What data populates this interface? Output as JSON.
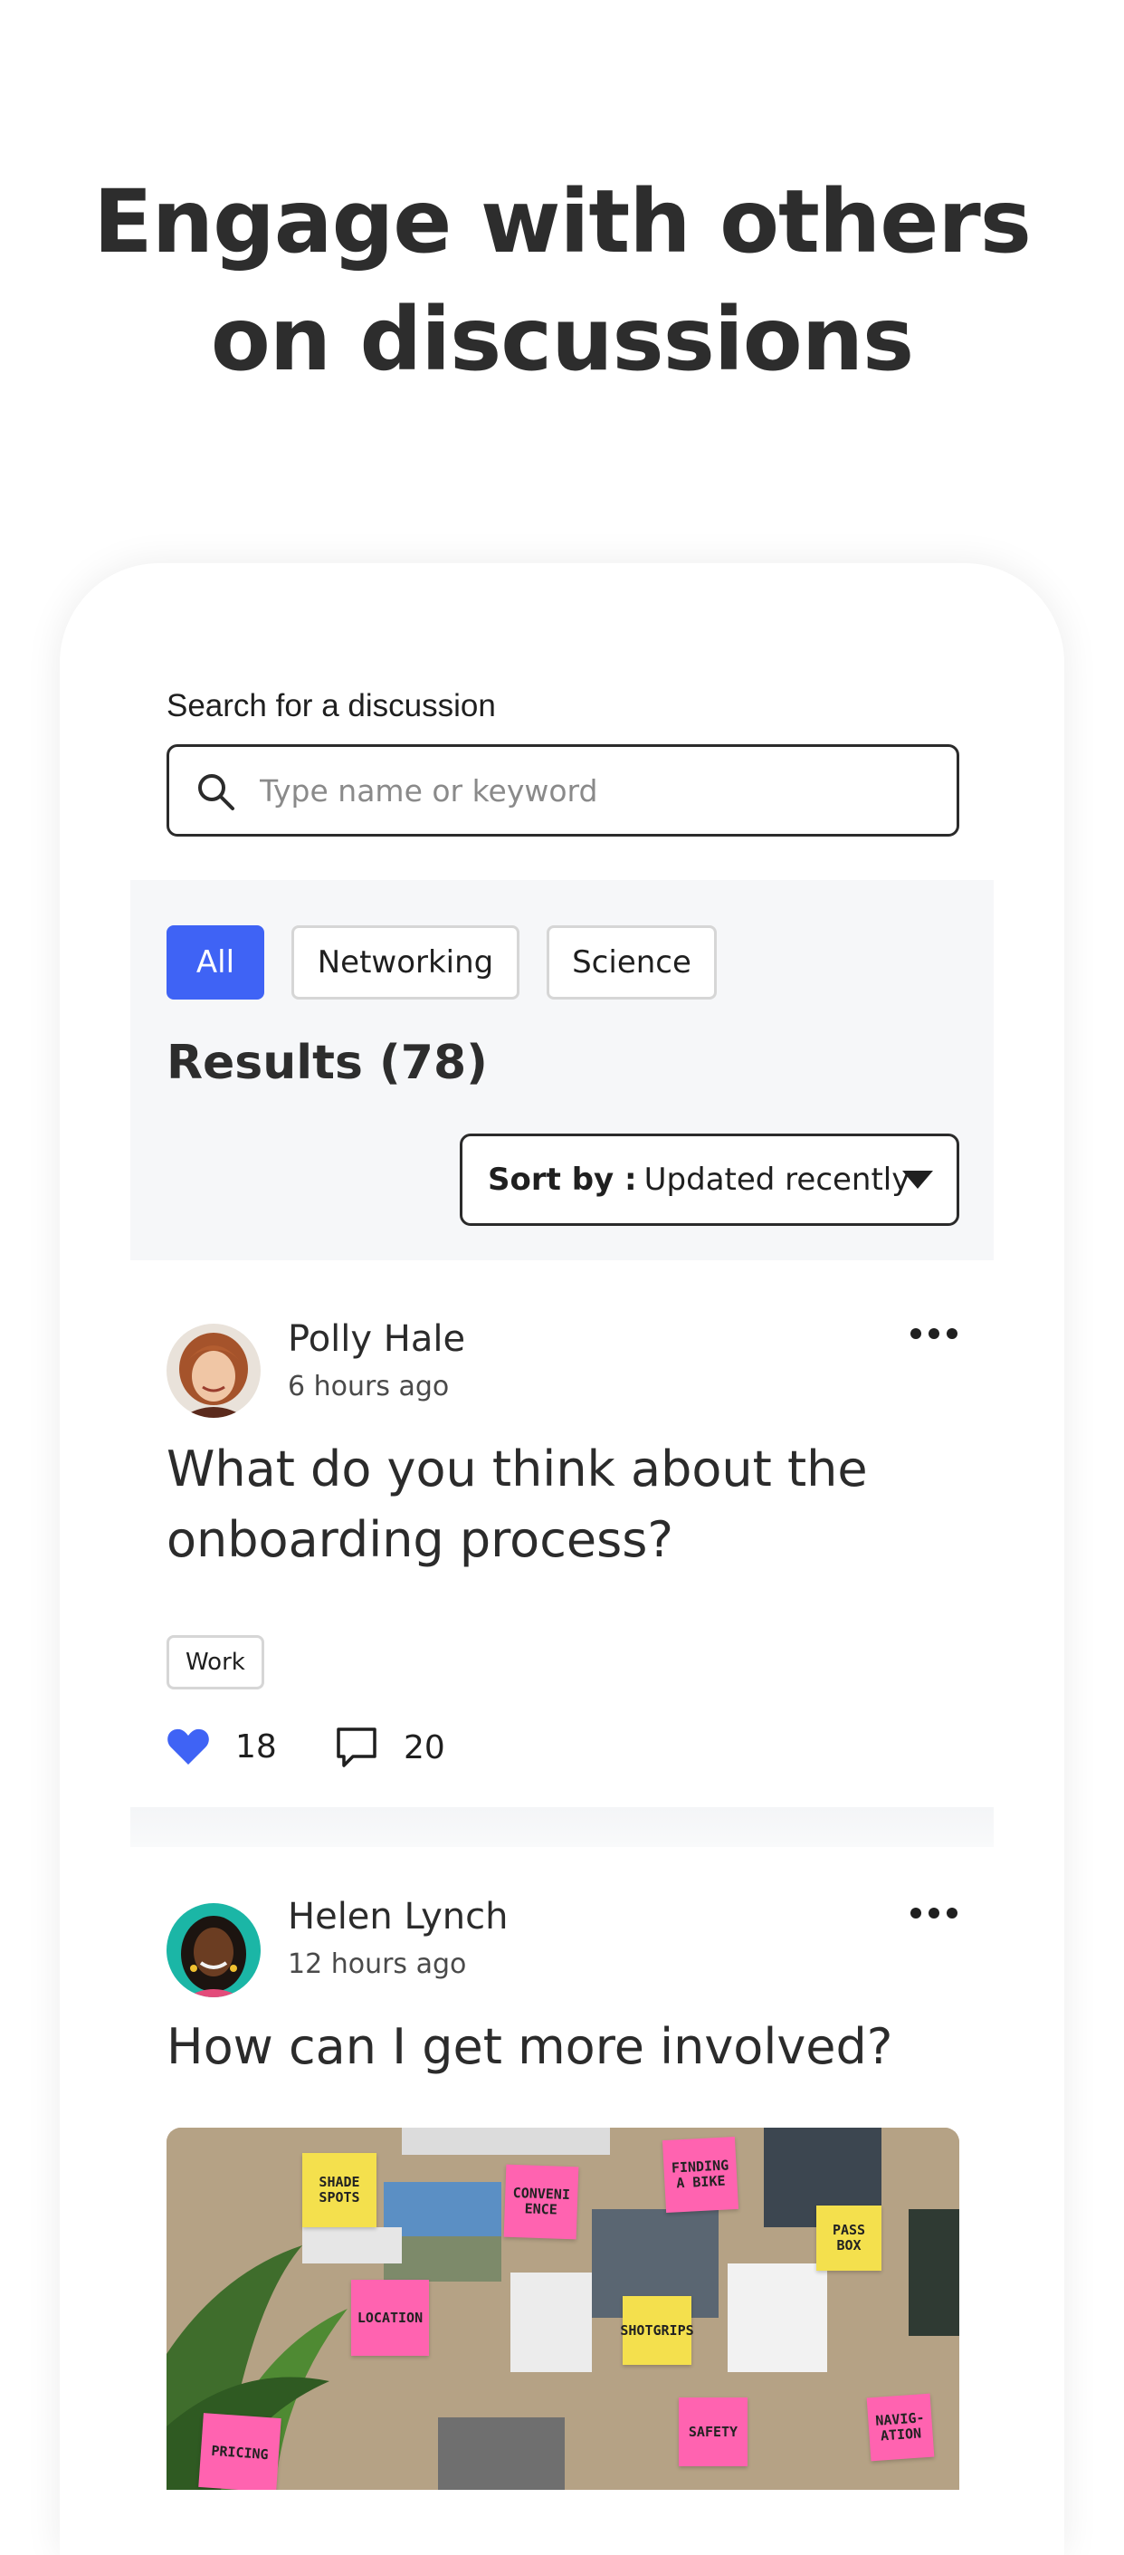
{
  "hero": {
    "line1": "Engage with others",
    "line2": "on discussions"
  },
  "search": {
    "label": "Search for a discussion",
    "placeholder": "Type name or keyword",
    "value": ""
  },
  "filters": {
    "chips": [
      "All",
      "Networking",
      "Science"
    ],
    "active": "All"
  },
  "results": {
    "label": "Results (78)"
  },
  "sort": {
    "key": "Sort by :",
    "value": "Updated recently"
  },
  "posts": [
    {
      "author": "Polly Hale",
      "time": "6 hours ago",
      "title_line1": "What do you think about the",
      "title_line2": "onboarding process?",
      "tag": "Work",
      "likes": "18",
      "comments": "20"
    },
    {
      "author": "Helen Lynch",
      "time": "12 hours ago",
      "title": "How can I get more involved?",
      "image_notes": [
        "SHADE SPOTS",
        "FINDING A BIKE",
        "CONVENI ENCE",
        "LOCATION",
        "SHOTGRIPS",
        "NAVIG- ATION",
        "SAFETY",
        "PRICING",
        "PASS BOX"
      ]
    }
  ],
  "colors": {
    "accent": "#3f63f5",
    "text": "#2b2b2b",
    "panel": "#f6f7f9"
  }
}
